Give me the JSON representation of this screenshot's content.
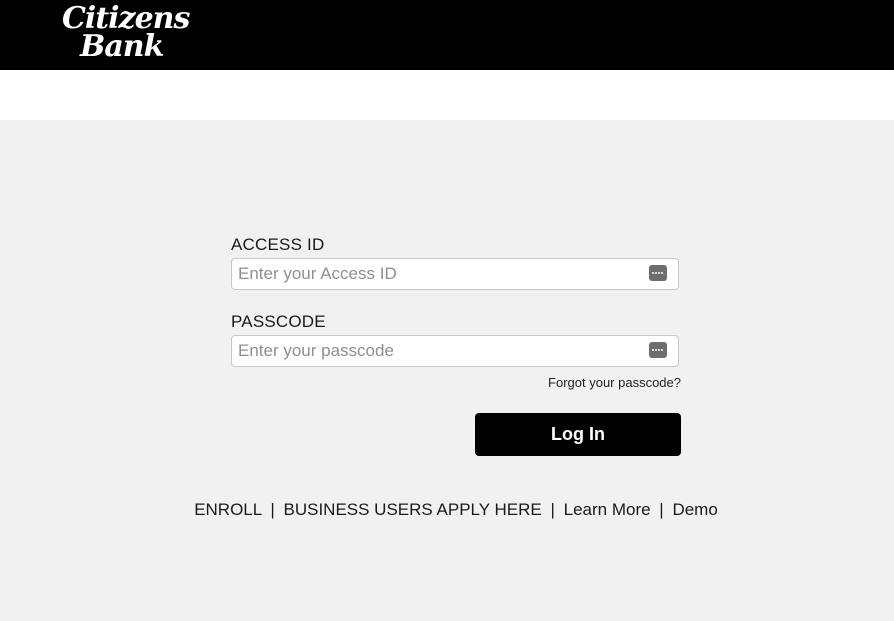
{
  "brand": {
    "logo_line1": "Citizens",
    "logo_line2": "Bank"
  },
  "login": {
    "access_id": {
      "label": "ACCESS ID",
      "placeholder": "Enter your Access ID",
      "value": ""
    },
    "passcode": {
      "label": "PASSCODE",
      "placeholder": "Enter your passcode",
      "value": ""
    },
    "forgot_label": "Forgot your passcode?",
    "submit_label": "Log In"
  },
  "footer_links": {
    "enroll": "ENROLL",
    "business": "BUSINESS USERS APPLY HERE",
    "learn_more": "Learn More",
    "demo": "Demo",
    "separator": "|"
  },
  "colors": {
    "header_bg": "#000000",
    "page_bg": "#f1f1f1",
    "button_bg": "#000000",
    "button_text": "#ffffff"
  },
  "icons": {
    "password_manager": "password-dots-icon"
  }
}
